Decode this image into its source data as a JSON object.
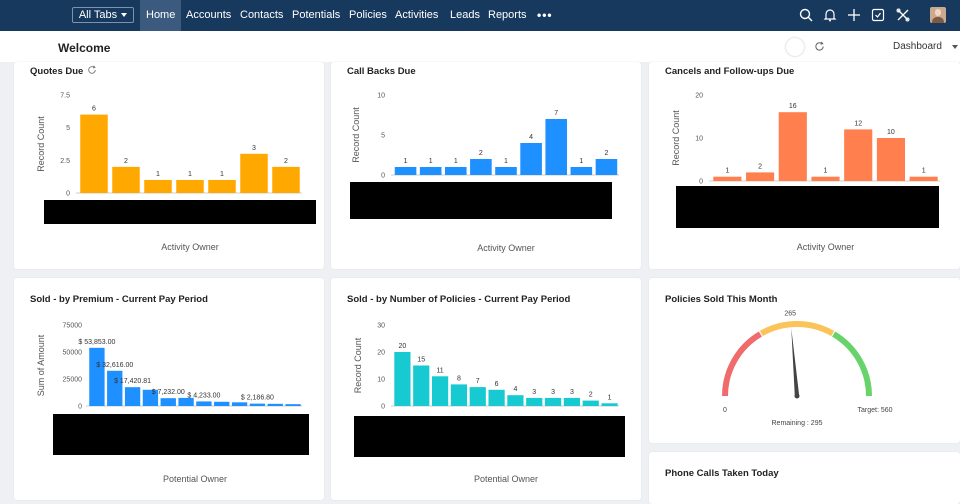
{
  "nav": {
    "all_tabs": "All Tabs",
    "tabs": [
      "Home",
      "Accounts",
      "Contacts",
      "Potentials",
      "Policies",
      "Activities",
      "Leads",
      "Reports"
    ],
    "more": "•••",
    "icons": [
      "search-icon",
      "bell-icon",
      "plus-icon",
      "calendar-icon",
      "tools-icon",
      "avatar"
    ]
  },
  "header": {
    "welcome": "Welcome",
    "dashboard_select": "Dashboard"
  },
  "colors": {
    "nav_bg": "#17395e",
    "orange": "#ffa800",
    "blue": "#1e90ff",
    "salmon": "#ff7f4f",
    "cyan": "#17c9d0"
  },
  "cards": {
    "quotes_due": {
      "title": "Quotes Due",
      "xlabel": "Activity Owner",
      "ylabel": "Record Count"
    },
    "call_backs": {
      "title": "Call Backs Due",
      "xlabel": "Activity Owner",
      "ylabel": "Record Count"
    },
    "cancels": {
      "title": "Cancels and Follow-ups Due",
      "xlabel": "Activity Owner",
      "ylabel": "Record Count"
    },
    "sold_premium": {
      "title": "Sold - by Premium - Current Pay Period",
      "xlabel": "Potential Owner",
      "ylabel": "Sum of Amount"
    },
    "sold_policies": {
      "title": "Sold - by Number of Policies - Current Pay Period",
      "xlabel": "Potential Owner",
      "ylabel": "Record Count"
    },
    "policies_month": {
      "title": "Policies Sold This Month"
    },
    "phone_calls": {
      "title": "Phone Calls Taken Today"
    }
  },
  "chart_data": [
    {
      "id": "quotes_due",
      "type": "bar",
      "values": [
        6,
        2,
        1,
        1,
        1,
        3,
        2
      ],
      "ylim": [
        0,
        7.5
      ],
      "yticks": [
        "0",
        "2.5",
        "5",
        "7.5"
      ],
      "color": "#ffa800"
    },
    {
      "id": "call_backs",
      "type": "bar",
      "values": [
        1,
        1,
        1,
        2,
        1,
        4,
        7,
        1,
        2
      ],
      "ylim": [
        0,
        10
      ],
      "yticks": [
        "0",
        "5",
        "10"
      ],
      "color": "#1e90ff"
    },
    {
      "id": "cancels",
      "type": "bar",
      "values": [
        1,
        2,
        16,
        1,
        12,
        10,
        1
      ],
      "ylim": [
        0,
        20
      ],
      "yticks": [
        "0",
        "10",
        "20"
      ],
      "color": "#ff7f4f"
    },
    {
      "id": "sold_premium",
      "type": "bar",
      "values": [
        53853,
        32616,
        17420.81,
        15000,
        7232,
        7500,
        4233,
        3900,
        3400,
        2186.8,
        2000,
        1700
      ],
      "labels": [
        "$ 53,853.00",
        "$ 32,616.00",
        "$ 17,420.81",
        "",
        "$ 7,232.00",
        "",
        "$ 4,233.00",
        "",
        "",
        "$ 2,186.80",
        "",
        ""
      ],
      "ylim": [
        0,
        75000
      ],
      "yticks": [
        "0",
        "25000",
        "50000",
        "75000"
      ],
      "color": "#1e90ff"
    },
    {
      "id": "sold_policies",
      "type": "bar",
      "values": [
        20,
        15,
        11,
        8,
        7,
        6,
        4,
        3,
        3,
        3,
        2,
        1
      ],
      "ylim": [
        0,
        30
      ],
      "yticks": [
        "0",
        "10",
        "20",
        "30"
      ],
      "color": "#17c9d0"
    },
    {
      "id": "policies_month",
      "type": "gauge",
      "value": 265,
      "min": 0,
      "target": 560,
      "min_label": "0",
      "target_label": "Target: 560",
      "value_label": "265",
      "remaining_label": "Remaining : 295"
    }
  ]
}
